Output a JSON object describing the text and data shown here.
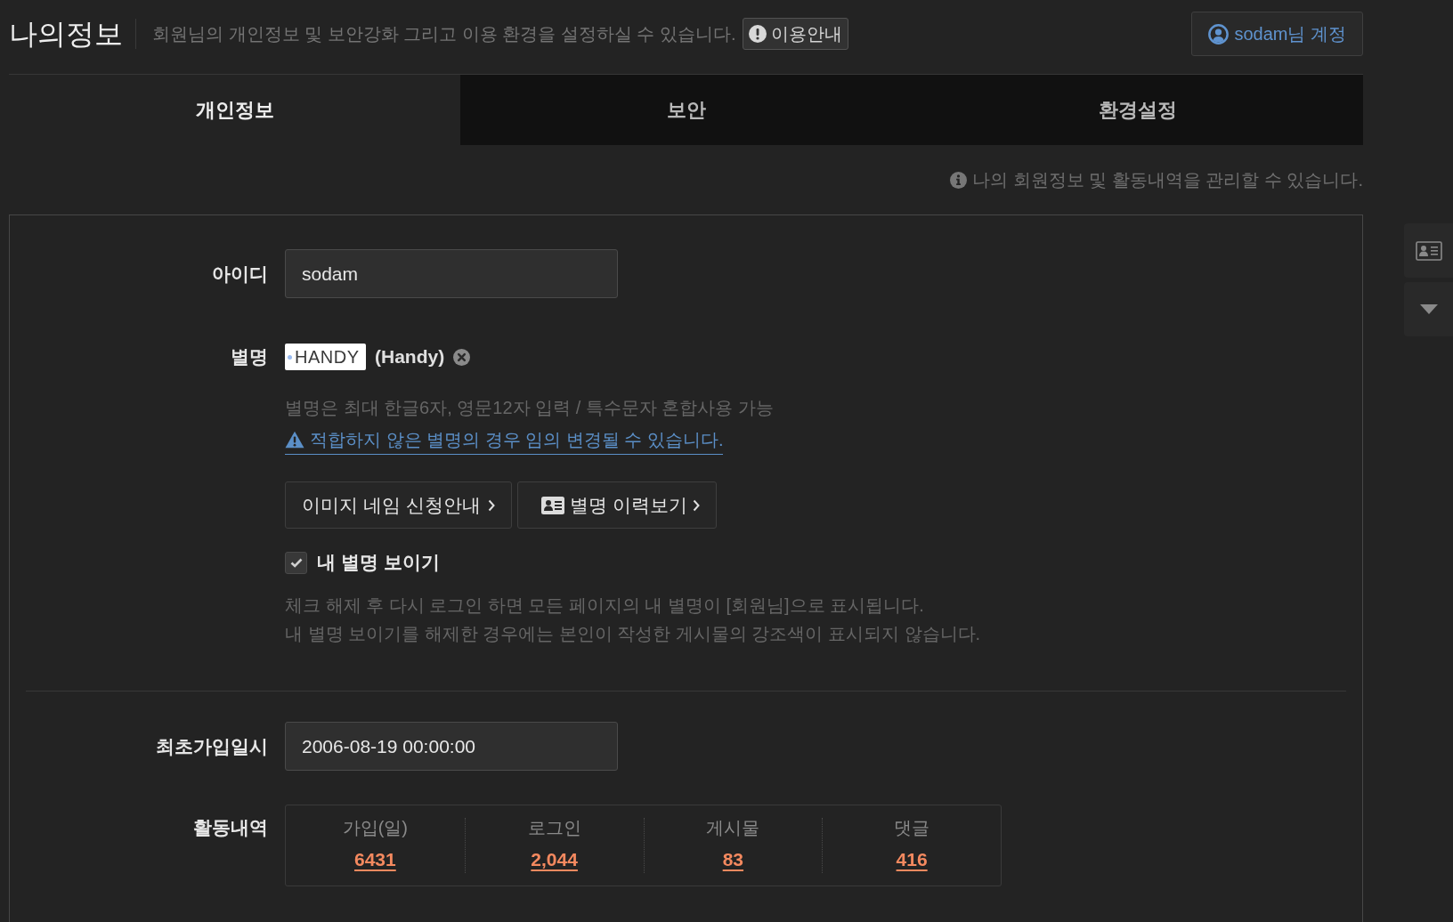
{
  "header": {
    "title": "나의정보",
    "description": "회원님의 개인정보 및 보안강화 그리고 이용 환경을 설정하실 수 있습니다.",
    "guide_button": "이용안내",
    "account_button": "sodam님 계정"
  },
  "tabs": [
    {
      "label": "개인정보",
      "selected": true
    },
    {
      "label": "보안",
      "selected": false
    },
    {
      "label": "환경설정",
      "selected": false
    }
  ],
  "info_note": "나의 회원정보 및 활동내역을 관리할 수 있습니다.",
  "form": {
    "user_id": {
      "label": "아이디",
      "value": "sodam"
    },
    "nickname": {
      "label": "별명",
      "image_name": "HANDY",
      "name": "(Handy)",
      "hint": "별명은 최대 한글6자, 영문12자 입력 / 특수문자 혼합사용 가능",
      "warning": "적합하지 않은 별명의 경우 임의 변경될 수 있습니다.",
      "buttons": [
        {
          "label": "이미지 네임 신청안내",
          "kind": "guide"
        },
        {
          "label": "별명 이력보기",
          "kind": "history"
        }
      ],
      "show_nickname": {
        "label": "내 별명 보이기",
        "checked": true
      },
      "notes": [
        "체크 해제 후 다시 로그인 하면 모든 페이지의 내 별명이 [회원님]으로 표시됩니다.",
        "내 별명 보이기를 해제한 경우에는 본인이 작성한 게시물의 강조색이 표시되지 않습니다."
      ]
    },
    "join_date": {
      "label": "최초가입일시",
      "value": "2006-08-19 00:00:00"
    },
    "activity": {
      "label": "활동내역",
      "stats": [
        {
          "label": "가입(일)",
          "value": "6431"
        },
        {
          "label": "로그인",
          "value": "2,044"
        },
        {
          "label": "게시물",
          "value": "83"
        },
        {
          "label": "댓글",
          "value": "416"
        }
      ]
    }
  }
}
